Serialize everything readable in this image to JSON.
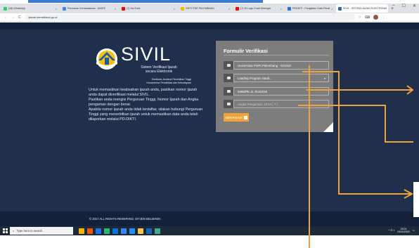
{
  "browser": {
    "tabs": [
      {
        "label": "(28) WhatsApp",
        "color": "#25d366"
      },
      {
        "label": "Pencarian Kemahasiswa - UNSRI",
        "color": "#4285f4"
      },
      {
        "label": "(7) YouTube",
        "color": "#ff0000"
      },
      {
        "label": "DIKTI PDR PALEMBANG",
        "color": "#f4b400"
      },
      {
        "label": "(7) 20 Lagu Enak Didengar",
        "color": "#ff0000"
      },
      {
        "label": "PDDIKTI - Pangkalan Data Pendi",
        "color": "#1a73e8"
      },
      {
        "label": "SIVIL - SISTEM IJAZAH ELEKTRONIK",
        "color": "#3366aa",
        "active": true
      }
    ],
    "new_tab": "+",
    "window_controls": [
      "–",
      "☐",
      "✕"
    ],
    "address": "ijazah.kemdikbud.go.id",
    "nav": [
      "←",
      "→",
      "C"
    ],
    "addr_icons": [
      "☆",
      "⌨"
    ]
  },
  "logo": {
    "name": "SIVIL",
    "subtitle_1": "Sistem Verifikasi Ijazah",
    "subtitle_2": "secara Elektronik",
    "directorate_1": "Direktorat Jenderal Pendidikan Tinggi",
    "directorate_2": "Kementerian Pendidikan dan Kebudayaan"
  },
  "description": {
    "p1": "Untuk memastikan keabsahan ijazah anda, pastikan nomor ijazah anda dapat diverifikasi melalui SIVIL.",
    "p2": "Pastikan anda mengisi Perguruan Tinggi, Nomor Ijazah dan Angka pengaman dengan benar.",
    "p3": "Apabila nomor ijazah anda tidak terdaftar, silakan hubungi Perguruan Tinggi yang menerbitkan ijazah untuk memastikan data anda telah dilaporkan melalui PD-DIKTI."
  },
  "form": {
    "title": "Formulir Verifikasi",
    "university": "Universitas PGRI Palembang - 021018",
    "program": "Loading Program Studi...",
    "ijazah_number": "0306/PE.11.7ko/2018",
    "security_placeholder": "Angka Pengaman: 10'44 ( ? )",
    "verify_label": "VERIFIKASI",
    "verify_icon": "›",
    "field_icons": [
      "university-icon",
      "book-icon",
      "id-card-icon",
      "lock-icon"
    ],
    "select_caret": "▾"
  },
  "footer": {
    "text": "© 2017 ALL RIGHTS RESERVED. DITJEN BELMAWA"
  },
  "taskbar": {
    "search_placeholder": "Type here to search",
    "clock_time": "15:01",
    "clock_date": "03/11/2020",
    "tray_text": "^ ☷ ⌽",
    "apps": [
      "#f4b400",
      "#e8590c",
      "#1a73e8",
      "#2bb673",
      "#0078d4",
      "#3a86ff",
      "#1e90ff",
      "#f9c74f",
      "#1565c0",
      "#43aa8b"
    ]
  },
  "colors": {
    "page_bg": "#1f2f4c",
    "panel_bg": "#7d7d7d",
    "button": "#f0a33a",
    "annotation_orange": "#f0a33a",
    "annotation_blue": "#3a7bd5"
  }
}
